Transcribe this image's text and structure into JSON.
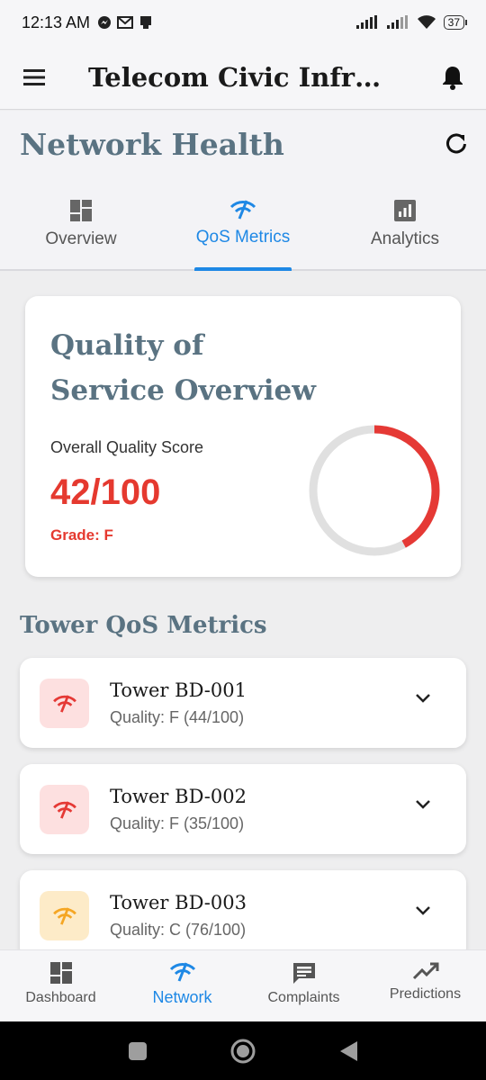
{
  "status_bar": {
    "time": "12:13 AM",
    "battery": "37"
  },
  "app_bar": {
    "title": "Telecom Civic Infrastr..."
  },
  "header": {
    "title": "Network Health"
  },
  "tabs": [
    {
      "label": "Overview",
      "icon": "dashboard-icon",
      "active": false
    },
    {
      "label": "QoS Metrics",
      "icon": "network-check-icon",
      "active": true
    },
    {
      "label": "Analytics",
      "icon": "analytics-icon",
      "active": false
    }
  ],
  "qos_overview": {
    "title": "Quality of Service Overview",
    "score_label": "Overall Quality Score",
    "score": "42/100",
    "score_value": 42,
    "grade": "Grade: F",
    "ring_color": "#e53935"
  },
  "tower_section": {
    "title": "Tower QoS Metrics",
    "towers": [
      {
        "name": "Tower BD-001",
        "quality": "Quality: F (44/100)",
        "color": "#e53935",
        "bg": "#fde0e0"
      },
      {
        "name": "Tower BD-002",
        "quality": "Quality: F (35/100)",
        "color": "#e53935",
        "bg": "#fde0e0"
      },
      {
        "name": "Tower BD-003",
        "quality": "Quality: C (76/100)",
        "color": "#f5a623",
        "bg": "#fdebc8"
      }
    ]
  },
  "bottom_nav": [
    {
      "label": "Dashboard",
      "icon": "dashboard-icon",
      "active": false
    },
    {
      "label": "Network",
      "icon": "network-check-icon",
      "active": true
    },
    {
      "label": "Complaints",
      "icon": "chat-icon",
      "active": false
    },
    {
      "label": "Predictions",
      "icon": "trending-up-icon",
      "active": false
    }
  ],
  "colors": {
    "accent": "#1e88e5",
    "heading": "#5a7382",
    "danger": "#e5392f"
  }
}
